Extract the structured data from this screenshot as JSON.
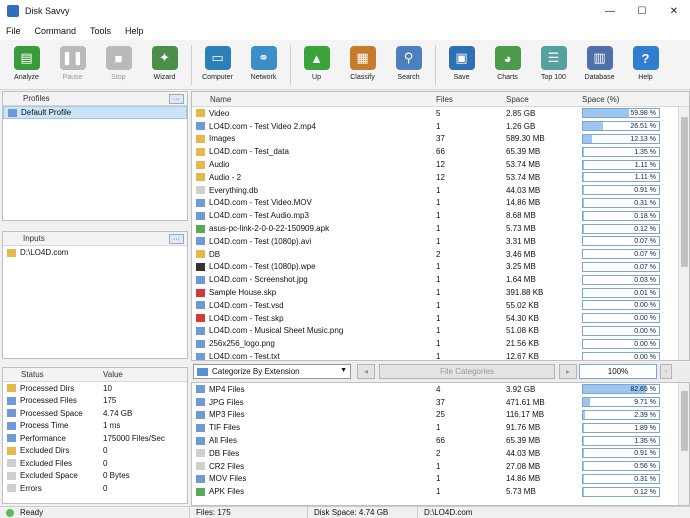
{
  "window": {
    "title": "Disk Savvy",
    "controls": {
      "minimize": "—",
      "maximize": "☐",
      "close": "✕"
    }
  },
  "menu": [
    "File",
    "Command",
    "Tools",
    "Help"
  ],
  "toolbar": [
    {
      "label": "Analyze",
      "icon": "analyze-icon",
      "color": "#3a9b3a",
      "glyph": "▤",
      "disabled": false
    },
    {
      "label": "Pause",
      "icon": "pause-icon",
      "color": "#b9b9b9",
      "glyph": "❚❚",
      "disabled": true
    },
    {
      "label": "Stop",
      "icon": "stop-icon",
      "color": "#b9b9b9",
      "glyph": "■",
      "disabled": true
    },
    {
      "label": "Wizard",
      "icon": "wizard-icon",
      "color": "#4a8f4a",
      "glyph": "✦",
      "disabled": false
    },
    {
      "label": "Computer",
      "icon": "computer-icon",
      "color": "#2c7fb8",
      "glyph": "▭",
      "disabled": false
    },
    {
      "label": "Network",
      "icon": "network-icon",
      "color": "#3b8fc9",
      "glyph": "⚭",
      "disabled": false
    },
    {
      "label": "Up",
      "icon": "up-arrow-icon",
      "color": "#3aa43a",
      "glyph": "▲",
      "disabled": false
    },
    {
      "label": "Classify",
      "icon": "classify-icon",
      "color": "#c77b2c",
      "glyph": "▦",
      "disabled": false
    },
    {
      "label": "Search",
      "icon": "search-icon",
      "color": "#4d7fbf",
      "glyph": "⚲",
      "disabled": false
    },
    {
      "label": "Save",
      "icon": "save-icon",
      "color": "#2f6fb3",
      "glyph": "▣",
      "disabled": false
    },
    {
      "label": "Charts",
      "icon": "charts-icon",
      "color": "#4c9a4c",
      "glyph": "◕",
      "disabled": false
    },
    {
      "label": "Top 100",
      "icon": "top-100-icon",
      "color": "#56a0a0",
      "glyph": "☰",
      "disabled": false
    },
    {
      "label": "Database",
      "icon": "database-icon",
      "color": "#4f6fa8",
      "glyph": "▥",
      "disabled": false
    },
    {
      "label": "Help",
      "icon": "help-icon",
      "color": "#2f7dd1",
      "glyph": "?",
      "disabled": false
    }
  ],
  "profiles": {
    "header": "Profiles",
    "header_btn": "···",
    "items": [
      "Default Profile"
    ]
  },
  "inputs": {
    "header": "Inputs",
    "header_btn": "···",
    "items": [
      "D:\\LO4D.com"
    ]
  },
  "status": {
    "col_status": "Status",
    "col_value": "Value",
    "rows": [
      {
        "label": "Processed Dirs",
        "value": "10",
        "color": "#e4b84b"
      },
      {
        "label": "Processed Files",
        "value": "175",
        "color": "#6f9ad6"
      },
      {
        "label": "Processed Space",
        "value": "4.74 GB",
        "color": "#6f9ad6"
      },
      {
        "label": "Process Time",
        "value": "1 ms",
        "color": "#6f9ad6"
      },
      {
        "label": "Performance",
        "value": "175000 Files/Sec",
        "color": "#6f9ad6"
      },
      {
        "label": "Excluded Dirs",
        "value": "0",
        "color": "#e4b84b"
      },
      {
        "label": "Excluded Files",
        "value": "0",
        "color": "#cfcfcf"
      },
      {
        "label": "Excluded Space",
        "value": "0 Bytes",
        "color": "#cfcfcf"
      },
      {
        "label": "Errors",
        "value": "0",
        "color": "#cfcfcf"
      }
    ]
  },
  "files_grid": {
    "columns": [
      "Name",
      "Files",
      "Space",
      "Space (%)"
    ],
    "rows": [
      {
        "name": "Video",
        "files": "5",
        "space": "2.85 GB",
        "pct": 59.98,
        "pct_text": "59.98 %",
        "color": "#e4b84b"
      },
      {
        "name": "LO4D.com - Test Video 2.mp4",
        "files": "1",
        "space": "1.26 GB",
        "pct": 26.51,
        "pct_text": "26.51 %",
        "color": "#6f9ad6"
      },
      {
        "name": "Images",
        "files": "37",
        "space": "589.30 MB",
        "pct": 12.13,
        "pct_text": "12.13 %",
        "color": "#e4b84b"
      },
      {
        "name": "LO4D.com - Test_data",
        "files": "66",
        "space": "65.39 MB",
        "pct": 1.35,
        "pct_text": "1.35 %",
        "color": "#e4b84b"
      },
      {
        "name": "Audio",
        "files": "12",
        "space": "53.74 MB",
        "pct": 1.11,
        "pct_text": "1.11 %",
        "color": "#e4b84b"
      },
      {
        "name": "Audio - 2",
        "files": "12",
        "space": "53.74 MB",
        "pct": 1.11,
        "pct_text": "1.11 %",
        "color": "#e4b84b"
      },
      {
        "name": "Everything.db",
        "files": "1",
        "space": "44.03 MB",
        "pct": 0.91,
        "pct_text": "0.91 %",
        "color": "#cfcfcf"
      },
      {
        "name": "LO4D.com - Test Video.MOV",
        "files": "1",
        "space": "14.86 MB",
        "pct": 0.31,
        "pct_text": "0.31 %",
        "color": "#6f9ad6"
      },
      {
        "name": "LO4D.com - Test Audio.mp3",
        "files": "1",
        "space": "8.68 MB",
        "pct": 0.18,
        "pct_text": "0.18 %",
        "color": "#6f9ad6"
      },
      {
        "name": "asus-pc-link-2-0-0-22-150909.apk",
        "files": "1",
        "space": "5.73 MB",
        "pct": 0.12,
        "pct_text": "0.12 %",
        "color": "#5aa85a"
      },
      {
        "name": "LO4D.com - Test (1080p).avi",
        "files": "1",
        "space": "3.31 MB",
        "pct": 0.07,
        "pct_text": "0.07 %",
        "color": "#6f9ad6"
      },
      {
        "name": "DB",
        "files": "2",
        "space": "3.46 MB",
        "pct": 0.07,
        "pct_text": "0.07 %",
        "color": "#e4b84b"
      },
      {
        "name": "LO4D.com - Test (1080p).wpe",
        "files": "1",
        "space": "3.25 MB",
        "pct": 0.07,
        "pct_text": "0.07 %",
        "color": "#333333"
      },
      {
        "name": "LO4D.com - Screenshot.jpg",
        "files": "1",
        "space": "1.64 MB",
        "pct": 0.03,
        "pct_text": "0.03 %",
        "color": "#6f9ad6"
      },
      {
        "name": "Sample House.skp",
        "files": "1",
        "space": "391.88 KB",
        "pct": 0.01,
        "pct_text": "0.01 %",
        "color": "#d33a3a"
      },
      {
        "name": "LO4D.com - Test.vsd",
        "files": "1",
        "space": "55.02 KB",
        "pct": 0.0,
        "pct_text": "0.00 %",
        "color": "#6f9ad6"
      },
      {
        "name": "LO4D.com - Test.skp",
        "files": "1",
        "space": "54.30 KB",
        "pct": 0.0,
        "pct_text": "0.00 %",
        "color": "#d33a3a"
      },
      {
        "name": "LO4D.com - Musical Sheet Music.png",
        "files": "1",
        "space": "51.08 KB",
        "pct": 0.0,
        "pct_text": "0.00 %",
        "color": "#6f9ad6"
      },
      {
        "name": "256x256_logo.png",
        "files": "1",
        "space": "21.56 KB",
        "pct": 0.0,
        "pct_text": "0.00 %",
        "color": "#6f9ad6"
      },
      {
        "name": "LO4D.com - Test.txt",
        "files": "1",
        "space": "12.67 KB",
        "pct": 0.0,
        "pct_text": "0.00 %",
        "color": "#6f9ad6"
      }
    ]
  },
  "category_bar": {
    "selected": "Categorize By Extension",
    "apply_btn": "File Categories",
    "pct_value": "100%"
  },
  "categories_grid": {
    "rows": [
      {
        "name": "MP4 Files",
        "files": "4",
        "space": "3.92 GB",
        "pct": 82.65,
        "pct_text": "82.65 %",
        "color": "#6f9ad6"
      },
      {
        "name": "JPG Files",
        "files": "37",
        "space": "471.61 MB",
        "pct": 9.71,
        "pct_text": "9.71 %",
        "color": "#6f9ad6"
      },
      {
        "name": "MP3 Files",
        "files": "25",
        "space": "116.17 MB",
        "pct": 2.39,
        "pct_text": "2.39 %",
        "color": "#6f9ad6"
      },
      {
        "name": "TIF Files",
        "files": "1",
        "space": "91.76 MB",
        "pct": 1.89,
        "pct_text": "1.89 %",
        "color": "#6f9ad6"
      },
      {
        "name": "All Files",
        "files": "66",
        "space": "65.39 MB",
        "pct": 1.35,
        "pct_text": "1.35 %",
        "color": "#6f9ad6"
      },
      {
        "name": "DB Files",
        "files": "2",
        "space": "44.03 MB",
        "pct": 0.91,
        "pct_text": "0.91 %",
        "color": "#cfcfcf"
      },
      {
        "name": "CR2 Files",
        "files": "1",
        "space": "27.08 MB",
        "pct": 0.56,
        "pct_text": "0.56 %",
        "color": "#cfcfcf"
      },
      {
        "name": "MOV Files",
        "files": "1",
        "space": "14.86 MB",
        "pct": 0.31,
        "pct_text": "0.31 %",
        "color": "#6f9ad6"
      },
      {
        "name": "APK Files",
        "files": "1",
        "space": "5.73 MB",
        "pct": 0.12,
        "pct_text": "0.12 %",
        "color": "#5aa85a"
      }
    ]
  },
  "statusbar": {
    "ready": "Ready",
    "files": "Files: 175",
    "disk_space": "Disk Space: 4.74 GB",
    "path": "D:\\LO4D.com"
  }
}
